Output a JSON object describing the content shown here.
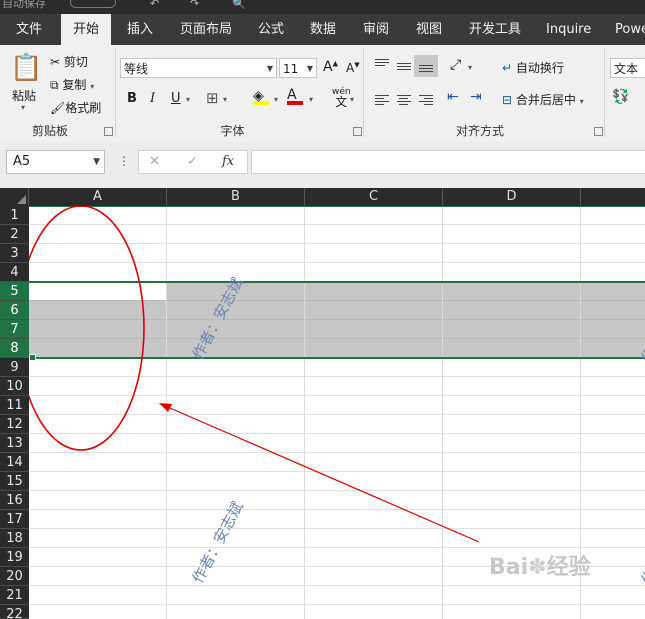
{
  "tabs": [
    "文件",
    "开始",
    "插入",
    "页面布局",
    "公式",
    "数据",
    "审阅",
    "视图",
    "开发工具",
    "Inquire",
    "Powe"
  ],
  "active_tab": 1,
  "clipboard": {
    "paste_label": "粘贴",
    "cut_label": "剪切",
    "copy_label": "复制",
    "format_painter_label": "格式刷",
    "group_label": "剪贴板"
  },
  "font": {
    "name_value": "等线",
    "size_value": "11",
    "grow_label": "A",
    "shrink_label": "A",
    "bold_label": "B",
    "italic_label": "I",
    "underline_label": "U",
    "color_label": "A",
    "phonetic_top": "wén",
    "phonetic_bottom": "文",
    "group_label": "字体"
  },
  "alignment": {
    "wrap_label": "自动换行",
    "merge_label": "合并后居中",
    "group_label": "对齐方式"
  },
  "number": {
    "format_value": "文本"
  },
  "formula_bar": {
    "name_box_value": "A5",
    "fx_label": "fx",
    "cancel_symbol": "✕",
    "enter_symbol": "✓",
    "dots": "⋮"
  },
  "columns": [
    "A",
    "B",
    "C",
    "D"
  ],
  "rows": [
    "1",
    "2",
    "3",
    "4",
    "5",
    "6",
    "7",
    "8",
    "9",
    "10",
    "11",
    "12",
    "13",
    "14",
    "15",
    "16",
    "17",
    "18",
    "19",
    "20",
    "21",
    "22"
  ],
  "selected_rows": [
    "5",
    "6",
    "7",
    "8"
  ],
  "watermark_text": "作者：安志斌",
  "colors": {
    "selection_fill": "#c6c6c6",
    "row_highlight": "#217346",
    "annotation": "#e00000",
    "watermark": "#6b86b3"
  }
}
